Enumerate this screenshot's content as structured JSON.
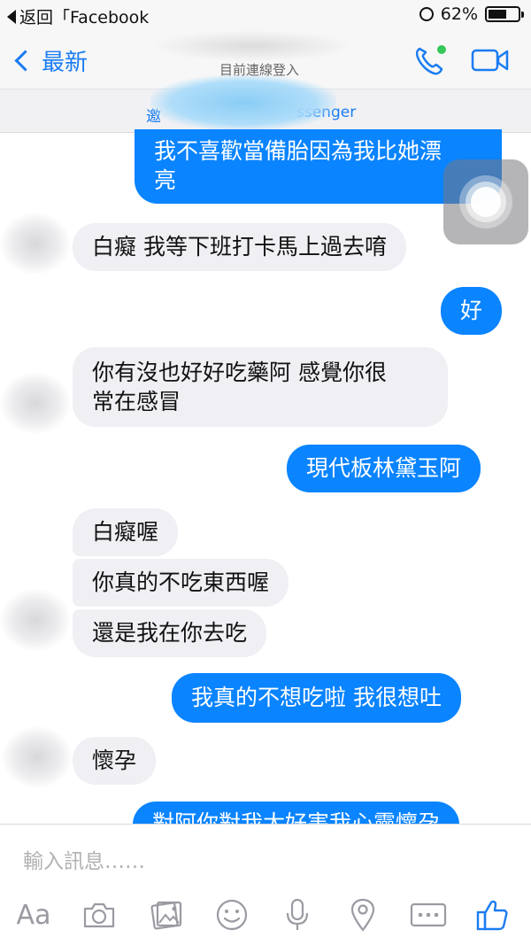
{
  "status_bar": {
    "back_app_label": "返回「Facebook",
    "battery_percent_label": "62%",
    "battery_level": 0.62
  },
  "nav": {
    "back_label": "最新",
    "subtitle": "目前連線登入",
    "phone_icon": "phone-icon",
    "video_icon": "video-camera-icon",
    "accent_color": "#1a7cf2",
    "online_dot_color": "#34c759"
  },
  "banner": {
    "prefix_text": "邀",
    "suffix_text": "ssenger"
  },
  "messages": [
    {
      "side": "out",
      "lines": [
        "我不喜歡當備胎因為我比她漂",
        "亮"
      ]
    },
    {
      "side": "in",
      "lines": [
        "白癡 我等下班打卡馬上過去唷"
      ]
    },
    {
      "side": "out",
      "lines": [
        "好"
      ]
    },
    {
      "side": "in",
      "lines": [
        "你有沒也好好吃藥阿 感覺你很",
        "常在感冒"
      ]
    },
    {
      "side": "out",
      "lines": [
        "現代板林黛玉阿"
      ]
    },
    {
      "side": "in",
      "lines": [
        "白癡喔"
      ]
    },
    {
      "side": "in",
      "lines": [
        "你真的不吃東西喔"
      ]
    },
    {
      "side": "in",
      "lines": [
        "還是我在你去吃"
      ]
    },
    {
      "side": "out",
      "lines": [
        "我真的不想吃啦 我很想吐"
      ]
    },
    {
      "side": "in",
      "lines": [
        "懷孕"
      ]
    },
    {
      "side": "out",
      "lines": [
        "對阿你對我太好害我心靈懷孕"
      ]
    }
  ],
  "composer": {
    "placeholder": "輸入訊息……",
    "aa_label": "Aa",
    "tools": [
      "text-format-icon",
      "camera-icon",
      "photo-gallery-icon",
      "sticker-smiley-icon",
      "microphone-icon",
      "location-pin-icon",
      "more-icon",
      "like-thumbs-up-icon"
    ]
  },
  "colors": {
    "outgoing_bubble": "#0a84ff",
    "incoming_bubble": "#efeff4",
    "toolbar_icon": "#9a9aa2",
    "like_icon": "#1a7cf2"
  }
}
